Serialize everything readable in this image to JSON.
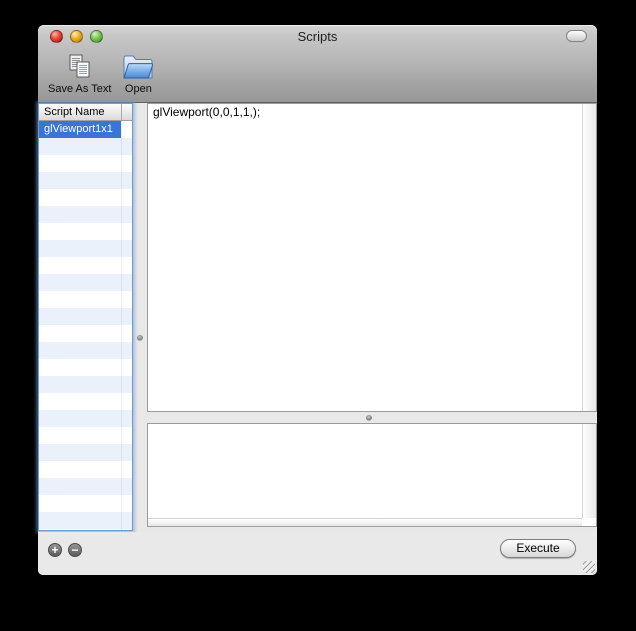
{
  "window": {
    "title": "Scripts",
    "controls": {
      "close": "close",
      "minimize": "minimize",
      "zoom": "zoom",
      "toolbar_toggle": "toolbar-pill"
    }
  },
  "toolbar": {
    "items": [
      {
        "icon": "save-as-text-icon",
        "label": "Save As Text"
      },
      {
        "icon": "open-folder-icon",
        "label": "Open"
      }
    ]
  },
  "script_list": {
    "header": "Script Name",
    "items": [
      {
        "name": "glViewport1x1",
        "selected": true
      }
    ]
  },
  "script_editor": {
    "content": "glViewport(0,0,1,1,);"
  },
  "output_panel": {
    "content": ""
  },
  "footer": {
    "add_button": "+",
    "remove_button": "−",
    "execute_button": "Execute"
  },
  "colors": {
    "selection_blue": "#3875d7",
    "row_stripe_blue": "#eaf1fb",
    "focus_ring": "#6f9bd1",
    "chrome_gray": "#e8e8e8",
    "titlebar_top": "#d4d4d4",
    "titlebar_bottom": "#979797",
    "desktop_background": "#000000"
  }
}
